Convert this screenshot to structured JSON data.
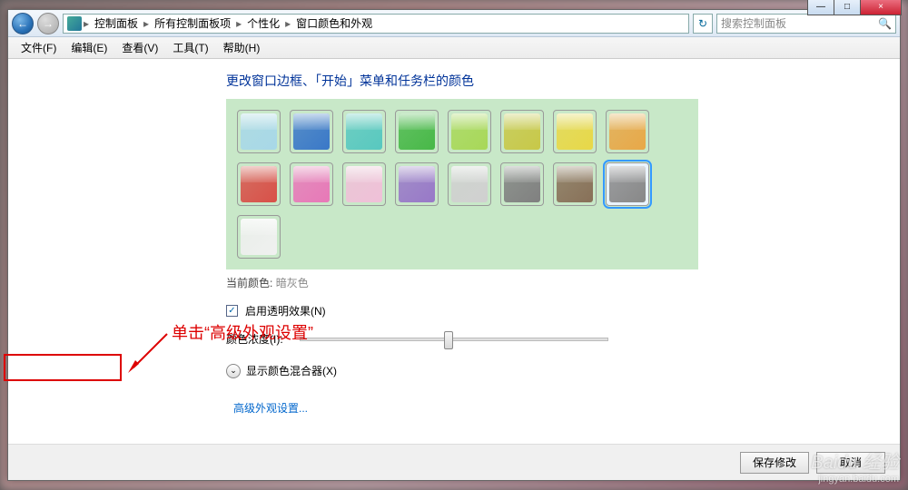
{
  "titlebar": {
    "min": "—",
    "max": "□",
    "close": "×"
  },
  "breadcrumb": {
    "items": [
      "控制面板",
      "所有控制面板项",
      "个性化",
      "窗口颜色和外观"
    ]
  },
  "refresh_icon": "↻",
  "search": {
    "placeholder": "搜索控制面板",
    "icon": "🔍"
  },
  "menu": {
    "file": "文件(F)",
    "edit": "编辑(E)",
    "view": "查看(V)",
    "tools": "工具(T)",
    "help": "帮助(H)"
  },
  "heading": "更改窗口边框、「开始」菜单和任务栏的颜色",
  "swatches": [
    {
      "name": "sky",
      "color": "#a8d8e8"
    },
    {
      "name": "blue",
      "color": "#3a78c8"
    },
    {
      "name": "teal",
      "color": "#58c8c0"
    },
    {
      "name": "green",
      "color": "#48b848"
    },
    {
      "name": "lime",
      "color": "#a8d858"
    },
    {
      "name": "olive",
      "color": "#c8c848"
    },
    {
      "name": "yellow",
      "color": "#e8d848"
    },
    {
      "name": "orange",
      "color": "#e8a848"
    },
    {
      "name": "red",
      "color": "#d85048"
    },
    {
      "name": "pink",
      "color": "#e878b8"
    },
    {
      "name": "lightpink",
      "color": "#f0c0d8"
    },
    {
      "name": "purple",
      "color": "#9878c8"
    },
    {
      "name": "lightgray",
      "color": "#d0d0d0"
    },
    {
      "name": "gray",
      "color": "#808080"
    },
    {
      "name": "brown",
      "color": "#887058"
    },
    {
      "name": "darkgray",
      "color": "#888888",
      "selected": true
    },
    {
      "name": "white",
      "color": "#f0f0f0"
    }
  ],
  "current_color": {
    "label": "当前颜色:",
    "value": "暗灰色"
  },
  "transparency": {
    "checked": true,
    "label": "启用透明效果(N)",
    "mark": "✓"
  },
  "intensity": {
    "label": "颜色浓度(I):"
  },
  "mixer": {
    "label": "显示颜色混合器(X)",
    "chevron": "⌄"
  },
  "advanced": {
    "label": "高级外观设置..."
  },
  "annotation": {
    "text": "单击“高级外观设置”"
  },
  "footer": {
    "save": "保存修改",
    "cancel": "取消"
  },
  "watermark": {
    "main": "Baidu 经验",
    "sub": "jingyan.baidu.com"
  }
}
